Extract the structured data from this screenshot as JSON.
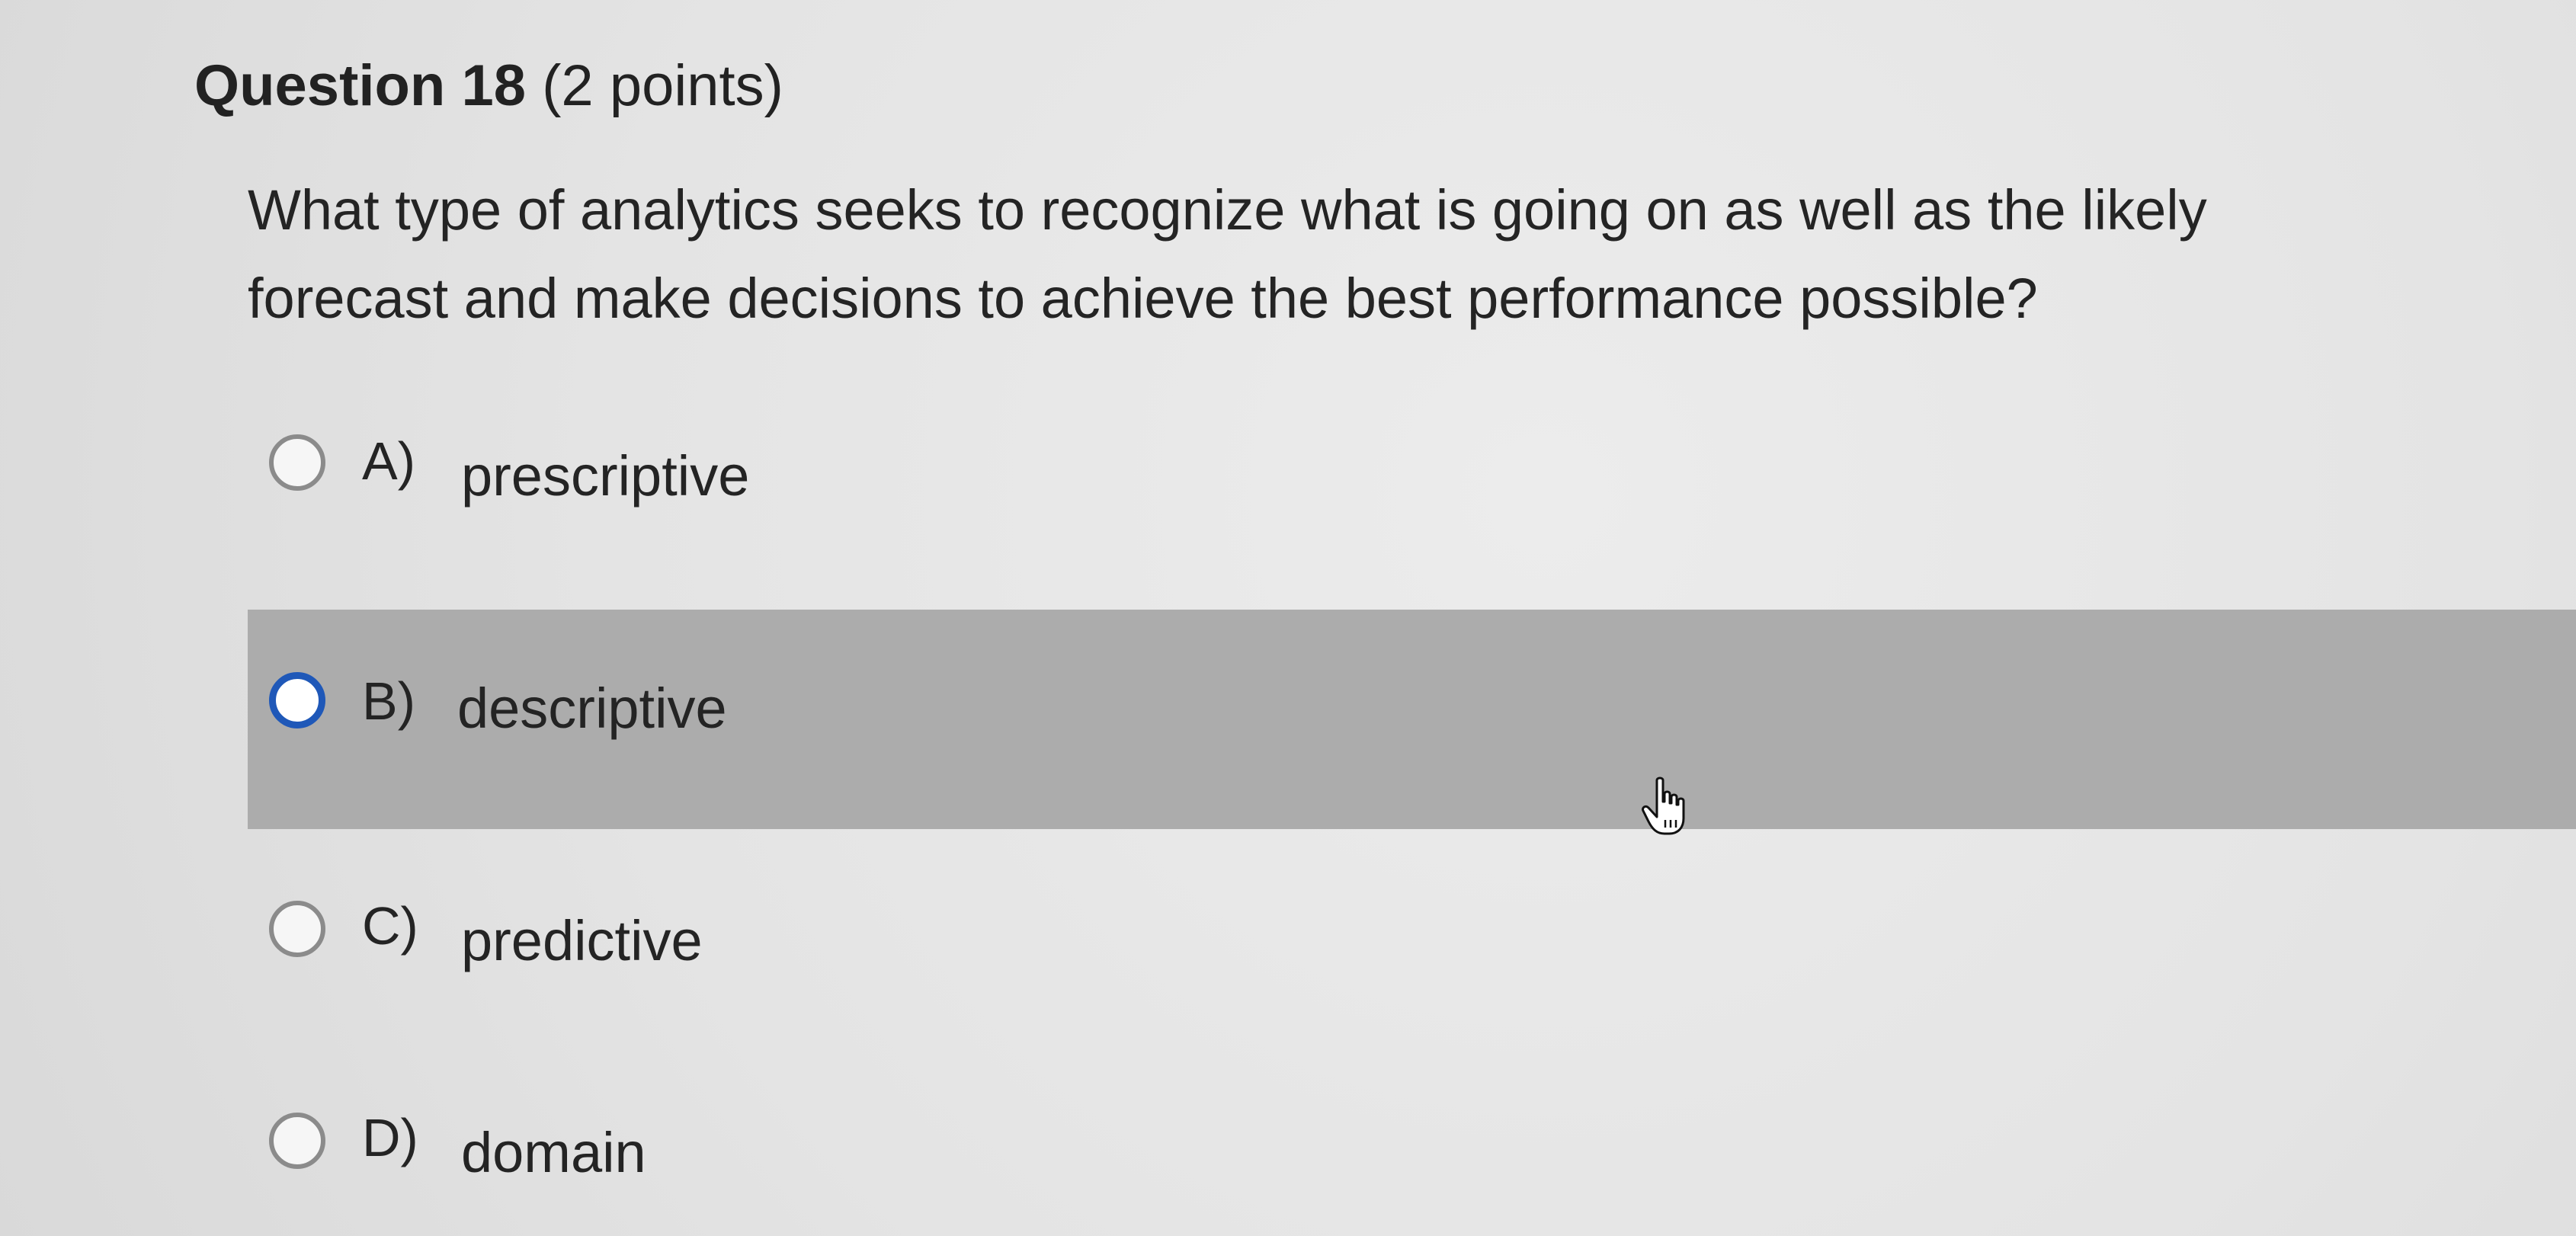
{
  "question": {
    "title": "Question 18",
    "points": "(2 points)",
    "text_line1": "What type of analytics seeks to recognize what is going on as well as the likely",
    "text_line2": "forecast and make decisions to achieve the best performance possible?"
  },
  "options": [
    {
      "letter": "A)",
      "text": "prescriptive",
      "selected": false,
      "hovered": false
    },
    {
      "letter": "B)",
      "text": "descriptive",
      "selected": false,
      "hovered": true
    },
    {
      "letter": "C)",
      "text": "predictive",
      "selected": false,
      "hovered": false
    },
    {
      "letter": "D)",
      "text": "domain",
      "selected": false,
      "hovered": false
    }
  ],
  "colors": {
    "background": "#e2e2e2",
    "hover_row": "#acacac",
    "radio_border": "#8b8b8b",
    "radio_focus_border": "#1f58b8",
    "text": "#242424"
  },
  "cursor": {
    "icon": "hand-pointer-icon"
  }
}
